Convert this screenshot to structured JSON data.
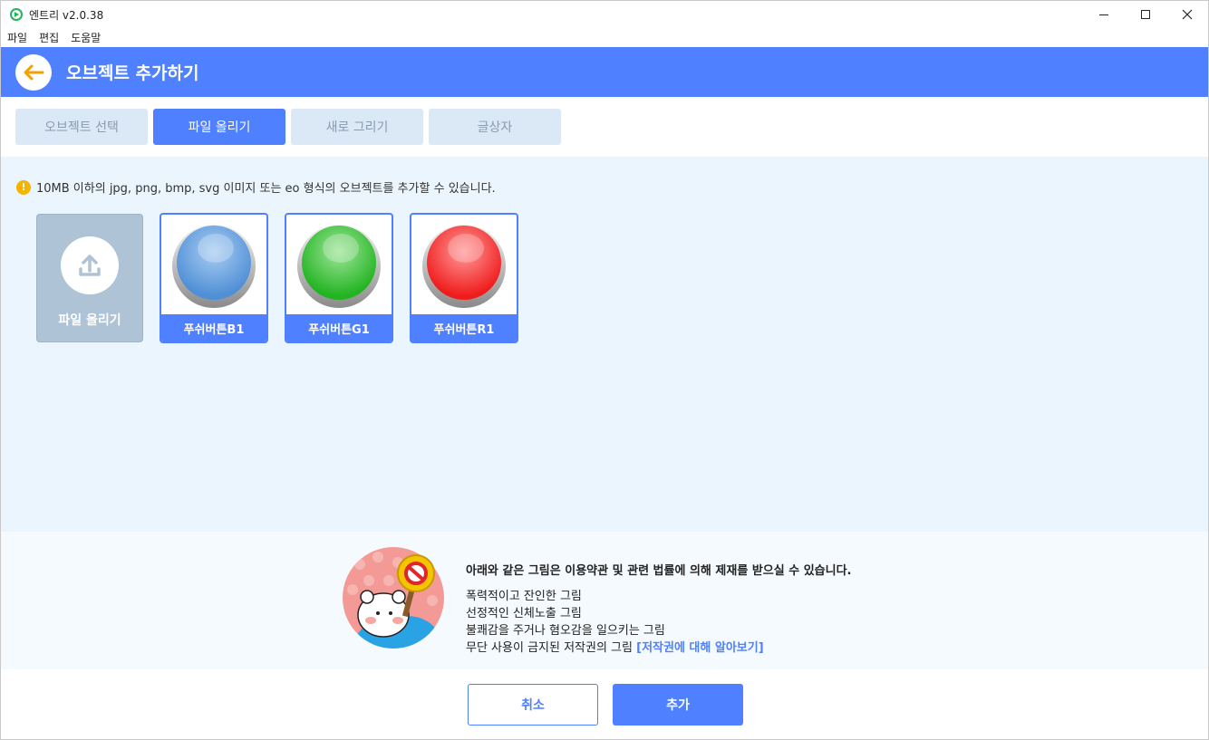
{
  "window": {
    "title": "엔트리 v2.0.38",
    "icon": "entry-logo-icon",
    "controls": [
      "minimize-icon",
      "maximize-icon",
      "close-icon"
    ]
  },
  "menu": {
    "items": [
      "파일",
      "편집",
      "도움말"
    ]
  },
  "header": {
    "title": "오브젝트 추가하기",
    "back_icon": "arrow-left-icon"
  },
  "tabs": [
    {
      "label": "오브젝트 선택",
      "active": false
    },
    {
      "label": "파일 올리기",
      "active": true
    },
    {
      "label": "새로 그리기",
      "active": false
    },
    {
      "label": "글상자",
      "active": false
    }
  ],
  "notice": {
    "icon": "warning-icon",
    "text": "10MB 이하의 jpg, png, bmp, svg 이미지 또는 eo 형식의 오브젝트를 추가할 수 있습니다."
  },
  "upload_tile": {
    "label": "파일 올리기",
    "icon": "upload-icon"
  },
  "objects": [
    {
      "label": "푸쉬버튼B1",
      "color": "#6fa8e0"
    },
    {
      "label": "푸쉬버튼G1",
      "color": "#3cc43c"
    },
    {
      "label": "푸쉬버튼R1",
      "color": "#ff3b3b"
    }
  ],
  "warning_panel": {
    "headline": "아래와 같은 그림은 이용약관 및 관련 법률에 의해 제재를 받으실 수 있습니다.",
    "lines": [
      "폭력적이고 잔인한 그림",
      "선정적인 신체노출 그림",
      "불쾌감을 주거나 혐오감을 일으키는 그림",
      "무단 사용이 금지된 저작권의 그림"
    ],
    "link": "[저작권에 대해 알아보기]"
  },
  "footer": {
    "cancel_label": "취소",
    "add_label": "추가"
  },
  "colors": {
    "accent": "#4f80ff",
    "content_bg": "#eaf5fd",
    "tab_inactive": "#dbe8f5"
  }
}
